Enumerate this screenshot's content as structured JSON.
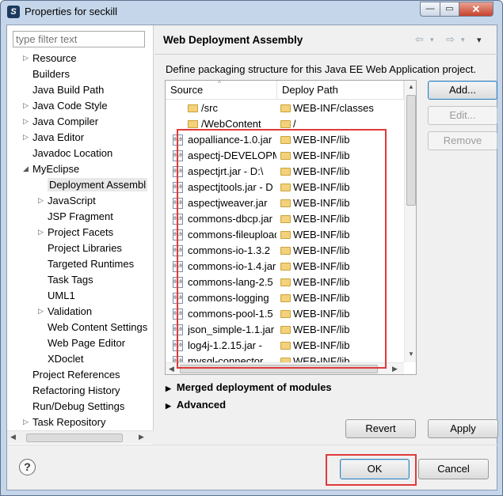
{
  "window": {
    "title": "Properties for seckill",
    "min_glyph": "—",
    "max_glyph": "▭",
    "close_glyph": "✕"
  },
  "filter": {
    "placeholder": "type filter text"
  },
  "tree": [
    {
      "label": "Resource",
      "expander": "▷",
      "level": 0
    },
    {
      "label": "Builders",
      "expander": "",
      "level": 0
    },
    {
      "label": "Java Build Path",
      "expander": "",
      "level": 0
    },
    {
      "label": "Java Code Style",
      "expander": "▷",
      "level": 0
    },
    {
      "label": "Java Compiler",
      "expander": "▷",
      "level": 0
    },
    {
      "label": "Java Editor",
      "expander": "▷",
      "level": 0
    },
    {
      "label": "Javadoc Location",
      "expander": "",
      "level": 0
    },
    {
      "label": "MyEclipse",
      "expander": "◢",
      "level": 0
    },
    {
      "label": "Deployment Assembl",
      "expander": "",
      "level": 1,
      "selected": true
    },
    {
      "label": "JavaScript",
      "expander": "▷",
      "level": 1
    },
    {
      "label": "JSP Fragment",
      "expander": "",
      "level": 1
    },
    {
      "label": "Project Facets",
      "expander": "▷",
      "level": 1
    },
    {
      "label": "Project Libraries",
      "expander": "",
      "level": 1
    },
    {
      "label": "Targeted Runtimes",
      "expander": "",
      "level": 1
    },
    {
      "label": "Task Tags",
      "expander": "",
      "level": 1
    },
    {
      "label": "UML1",
      "expander": "",
      "level": 1
    },
    {
      "label": "Validation",
      "expander": "▷",
      "level": 1
    },
    {
      "label": "Web Content Settings",
      "expander": "",
      "level": 1
    },
    {
      "label": "Web Page Editor",
      "expander": "",
      "level": 1
    },
    {
      "label": "XDoclet",
      "expander": "",
      "level": 1
    },
    {
      "label": "Project References",
      "expander": "",
      "level": 0
    },
    {
      "label": "Refactoring History",
      "expander": "",
      "level": 0
    },
    {
      "label": "Run/Debug Settings",
      "expander": "",
      "level": 0
    },
    {
      "label": "Task Repository",
      "expander": "▷",
      "level": 0
    }
  ],
  "page": {
    "title": "Web Deployment Assembly",
    "description": "Define packaging structure for this Java EE Web Application project.",
    "nav_back": "⇦",
    "nav_forward": "⇨",
    "nav_menu": "▾"
  },
  "table": {
    "col_source": "Source",
    "col_deploy": "Deploy Path",
    "rows": [
      {
        "source": "/src",
        "deploy": "WEB-INF/classes",
        "kind": "folder"
      },
      {
        "source": "/WebContent",
        "deploy": "/",
        "kind": "folder"
      },
      {
        "source": "aopalliance-1.0.jar",
        "deploy": "WEB-INF/lib",
        "kind": "jar"
      },
      {
        "source": "aspectj-DEVELOPMENT",
        "deploy": "WEB-INF/lib",
        "kind": "jar"
      },
      {
        "source": "aspectjrt.jar - D:\\",
        "deploy": "WEB-INF/lib",
        "kind": "jar"
      },
      {
        "source": "aspectjtools.jar - D",
        "deploy": "WEB-INF/lib",
        "kind": "jar"
      },
      {
        "source": "aspectjweaver.jar",
        "deploy": "WEB-INF/lib",
        "kind": "jar"
      },
      {
        "source": "commons-dbcp.jar",
        "deploy": "WEB-INF/lib",
        "kind": "jar"
      },
      {
        "source": "commons-fileupload",
        "deploy": "WEB-INF/lib",
        "kind": "jar"
      },
      {
        "source": "commons-io-1.3.2",
        "deploy": "WEB-INF/lib",
        "kind": "jar"
      },
      {
        "source": "commons-io-1.4.jar",
        "deploy": "WEB-INF/lib",
        "kind": "jar"
      },
      {
        "source": "commons-lang-2.5",
        "deploy": "WEB-INF/lib",
        "kind": "jar"
      },
      {
        "source": "commons-logging",
        "deploy": "WEB-INF/lib",
        "kind": "jar"
      },
      {
        "source": "commons-pool-1.5",
        "deploy": "WEB-INF/lib",
        "kind": "jar"
      },
      {
        "source": "json_simple-1.1.jar",
        "deploy": "WEB-INF/lib",
        "kind": "jar"
      },
      {
        "source": "log4j-1.2.15.jar -",
        "deploy": "WEB-INF/lib",
        "kind": "jar"
      },
      {
        "source": "mysql-connector",
        "deploy": "WEB-INF/lib",
        "kind": "jar"
      }
    ]
  },
  "buttons": {
    "add": "Add...",
    "edit": "Edit...",
    "remove": "Remove",
    "revert": "Revert",
    "apply": "Apply",
    "ok": "OK",
    "cancel": "Cancel"
  },
  "sections": {
    "merged": "Merged deployment of modules",
    "advanced": "Advanced",
    "expander": "▶"
  },
  "help_glyph": "?",
  "colors": {
    "highlight": "#e03a3a",
    "titlebar": "#c5d6ea"
  }
}
